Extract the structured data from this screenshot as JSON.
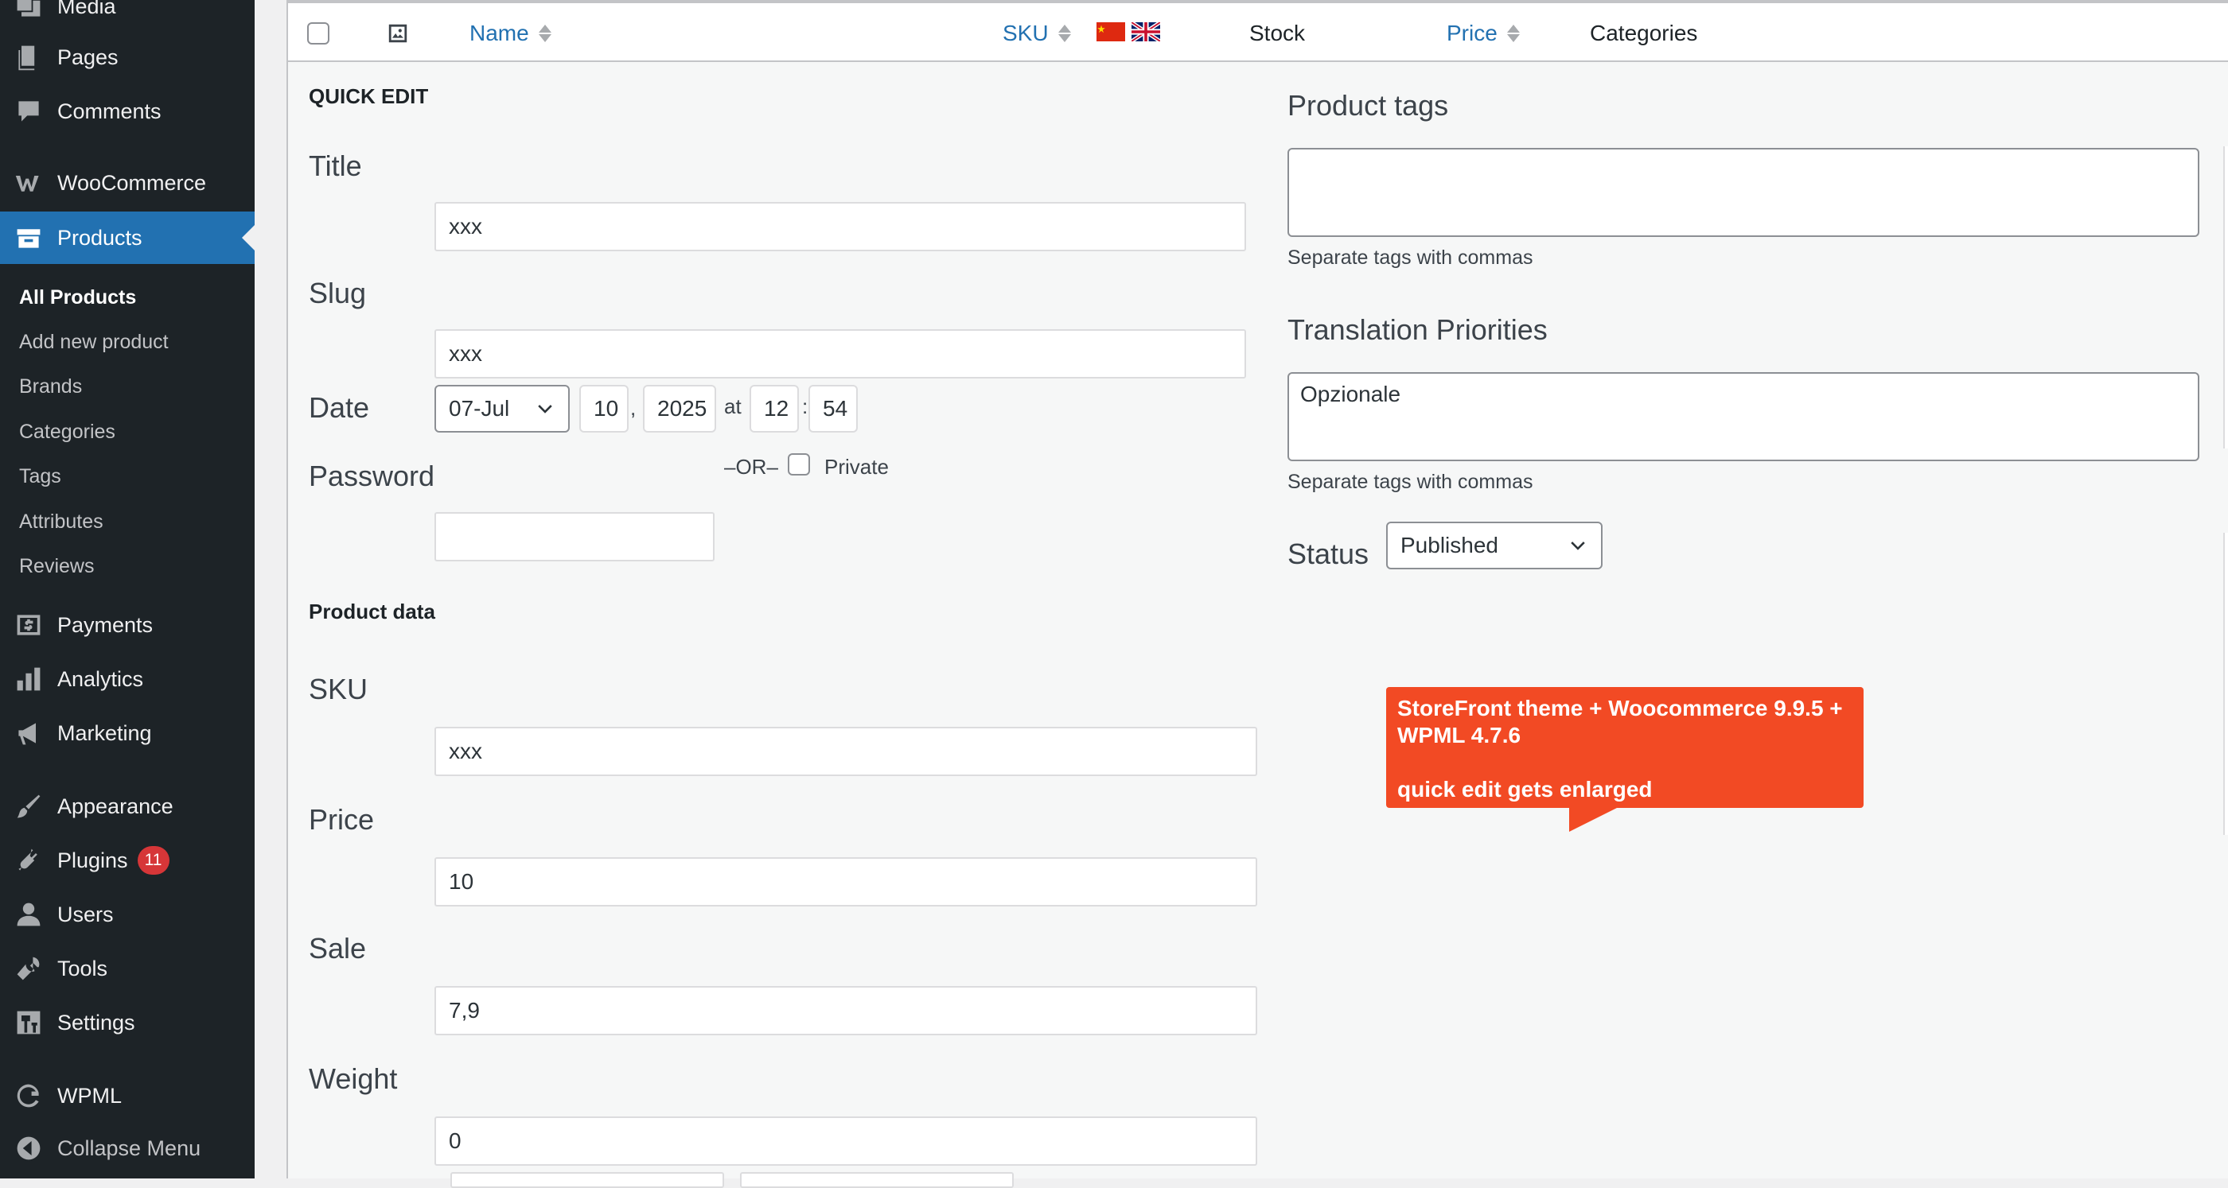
{
  "sidebar": {
    "menu": {
      "media": "Media",
      "pages": "Pages",
      "comments": "Comments",
      "woocommerce": "WooCommerce",
      "products": "Products",
      "payments": "Payments",
      "analytics": "Analytics",
      "marketing": "Marketing",
      "appearance": "Appearance",
      "plugins": "Plugins",
      "plugins_badge": "11",
      "users": "Users",
      "tools": "Tools",
      "settings": "Settings",
      "wpml": "WPML",
      "collapse": "Collapse Menu"
    },
    "submenu": {
      "all_products": "All Products",
      "add_new": "Add new product",
      "brands": "Brands",
      "categories": "Categories",
      "tags": "Tags",
      "attributes": "Attributes",
      "reviews": "Reviews"
    }
  },
  "table_header": {
    "name": "Name",
    "sku": "SKU",
    "stock": "Stock",
    "price": "Price",
    "categories": "Categories"
  },
  "quick_edit": {
    "heading": "QUICK EDIT",
    "title_label": "Title",
    "title_value": "xxx",
    "slug_label": "Slug",
    "slug_value": "xxx",
    "date_label": "Date",
    "date_month": "07-Jul",
    "date_day": "10",
    "date_comma": ",",
    "date_year": "2025",
    "date_at": "at",
    "date_hour": "12",
    "date_colon": ":",
    "date_minute": "54",
    "password_label": "Password",
    "or_text": "–OR–",
    "private_label": "Private",
    "password_value": "",
    "product_data_heading": "Product data",
    "sku_label": "SKU",
    "sku_value": "xxx",
    "price_label": "Price",
    "price_value": "10",
    "sale_label": "Sale",
    "sale_value": "7,9",
    "weight_label": "Weight",
    "weight_value": "0"
  },
  "right_column": {
    "tags_label": "Product tags",
    "tags_value": "",
    "tags_help": "Separate tags with commas",
    "priorities_label": "Translation Priorities",
    "priorities_value": "Opzionale",
    "priorities_help": "Separate tags with commas",
    "status_label": "Status",
    "status_value": "Published"
  },
  "annotation": {
    "line1": "StoreFront theme + Woocommerce 9.9.5 +",
    "line2": "WPML 4.7.6",
    "line3": "quick edit gets enlarged"
  },
  "colors": {
    "sidebar_bg": "#1d2327",
    "accent": "#2271b1",
    "badge": "#d63638",
    "annotation": "#f24a24"
  }
}
